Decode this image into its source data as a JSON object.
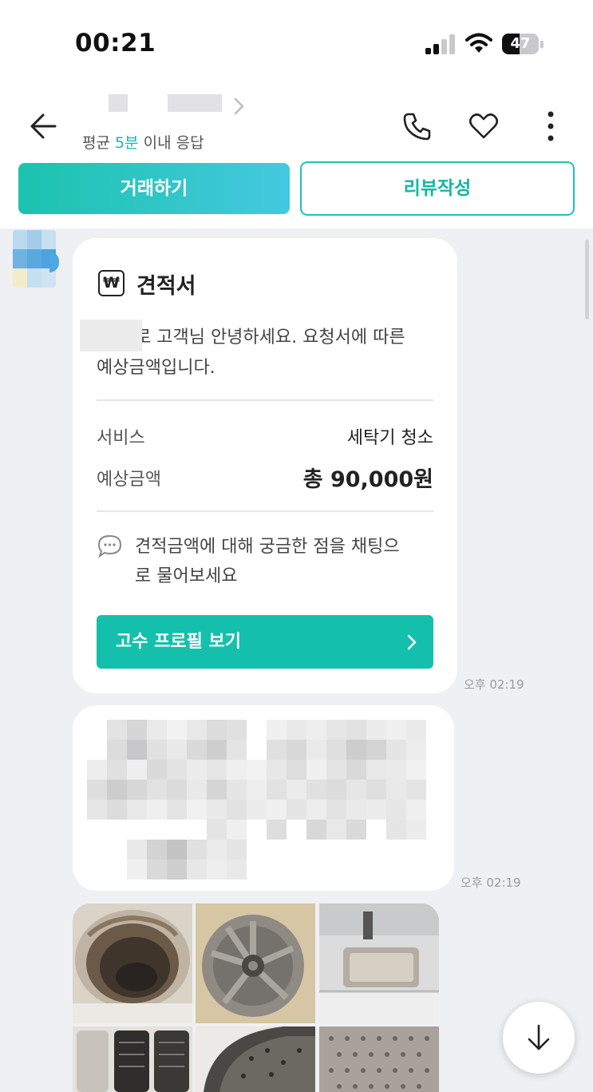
{
  "status_bar": {
    "time": "00:21",
    "battery": "47",
    "battery_level": 0.47
  },
  "header": {
    "response_prefix": "평균 ",
    "response_accent": "5분",
    "response_suffix": " 이내 응답",
    "deal_button": "거래하기",
    "review_button": "리뷰작성"
  },
  "quote": {
    "icon": "won-icon",
    "symbol": "₩",
    "title": "견적서",
    "greeting_line1": "로 고객님 안녕하세요. 요청서에 따른",
    "greeting_line2": "예상금액입니다.",
    "service_label": "서비스",
    "service_value": "세탁기 청소",
    "price_label": "예상금액",
    "price_value": "총 90,000원",
    "hint_line1": "견적금액에 대해 궁금한 점을 채팅으",
    "hint_line2": "로 물어보세요",
    "profile_button": "고수 프로필 보기",
    "time": "오후 02:19"
  },
  "message2": {
    "time": "오후 02:19"
  },
  "accent_color": "#14c0ac",
  "icons": [
    "back-arrow-icon",
    "chevron-right-icon",
    "phone-icon",
    "heart-icon",
    "more-vertical-icon",
    "chat-bubble-icon",
    "arrow-down-icon"
  ]
}
